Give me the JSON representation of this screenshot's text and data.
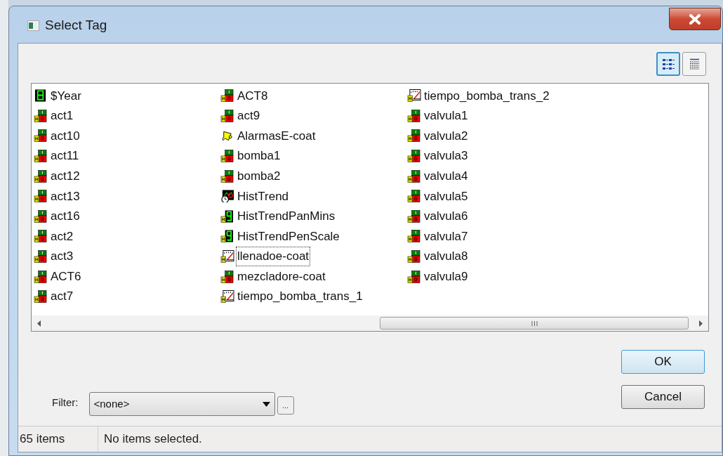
{
  "window": {
    "title": "Select Tag"
  },
  "view_buttons": [
    {
      "kind": "list",
      "selected": true
    },
    {
      "kind": "details",
      "selected": false
    }
  ],
  "tags": [
    {
      "name": "$Year",
      "kind": "digital",
      "focused": false
    },
    {
      "name": "act1",
      "kind": "discrete",
      "focused": false
    },
    {
      "name": "act10",
      "kind": "discrete",
      "focused": false
    },
    {
      "name": "act11",
      "kind": "discrete",
      "focused": false
    },
    {
      "name": "act12",
      "kind": "discrete",
      "focused": false
    },
    {
      "name": "act13",
      "kind": "discrete",
      "focused": false
    },
    {
      "name": "act16",
      "kind": "discrete",
      "focused": false
    },
    {
      "name": "act2",
      "kind": "discrete",
      "focused": false
    },
    {
      "name": "act3",
      "kind": "discrete",
      "focused": false
    },
    {
      "name": "ACT6",
      "kind": "discrete",
      "focused": false
    },
    {
      "name": "act7",
      "kind": "discrete",
      "focused": false
    },
    {
      "name": "ACT8",
      "kind": "discrete",
      "focused": false
    },
    {
      "name": "act9",
      "kind": "discrete",
      "focused": false
    },
    {
      "name": "AlarmasE-coat",
      "kind": "alarm",
      "focused": false
    },
    {
      "name": "bomba1",
      "kind": "discrete",
      "focused": false
    },
    {
      "name": "bomba2",
      "kind": "discrete",
      "focused": false
    },
    {
      "name": "HistTrend",
      "kind": "trend",
      "focused": false
    },
    {
      "name": "HistTrendPanMins",
      "kind": "integer",
      "focused": false
    },
    {
      "name": "HistTrendPenScale",
      "kind": "integer",
      "focused": false
    },
    {
      "name": "llenadoe-coat",
      "kind": "meter",
      "focused": true
    },
    {
      "name": "mezcladore-coat",
      "kind": "discrete",
      "focused": false
    },
    {
      "name": "tiempo_bomba_trans_1",
      "kind": "meter",
      "focused": false
    },
    {
      "name": "tiempo_bomba_trans_2",
      "kind": "meter",
      "focused": false
    },
    {
      "name": "valvula1",
      "kind": "discrete",
      "focused": false
    },
    {
      "name": "valvula2",
      "kind": "discrete",
      "focused": false
    },
    {
      "name": "valvula3",
      "kind": "discrete",
      "focused": false
    },
    {
      "name": "valvula4",
      "kind": "discrete",
      "focused": false
    },
    {
      "name": "valvula5",
      "kind": "discrete",
      "focused": false
    },
    {
      "name": "valvula6",
      "kind": "discrete",
      "focused": false
    },
    {
      "name": "valvula7",
      "kind": "discrete",
      "focused": false
    },
    {
      "name": "valvula8",
      "kind": "discrete",
      "focused": false
    },
    {
      "name": "valvula9",
      "kind": "discrete",
      "focused": false
    }
  ],
  "buttons": {
    "ok": "OK",
    "cancel": "Cancel"
  },
  "filter": {
    "label": "Filter:",
    "value": "<none>",
    "browse": "..."
  },
  "status_bar": {
    "count": "65 items",
    "message": "No items selected."
  }
}
